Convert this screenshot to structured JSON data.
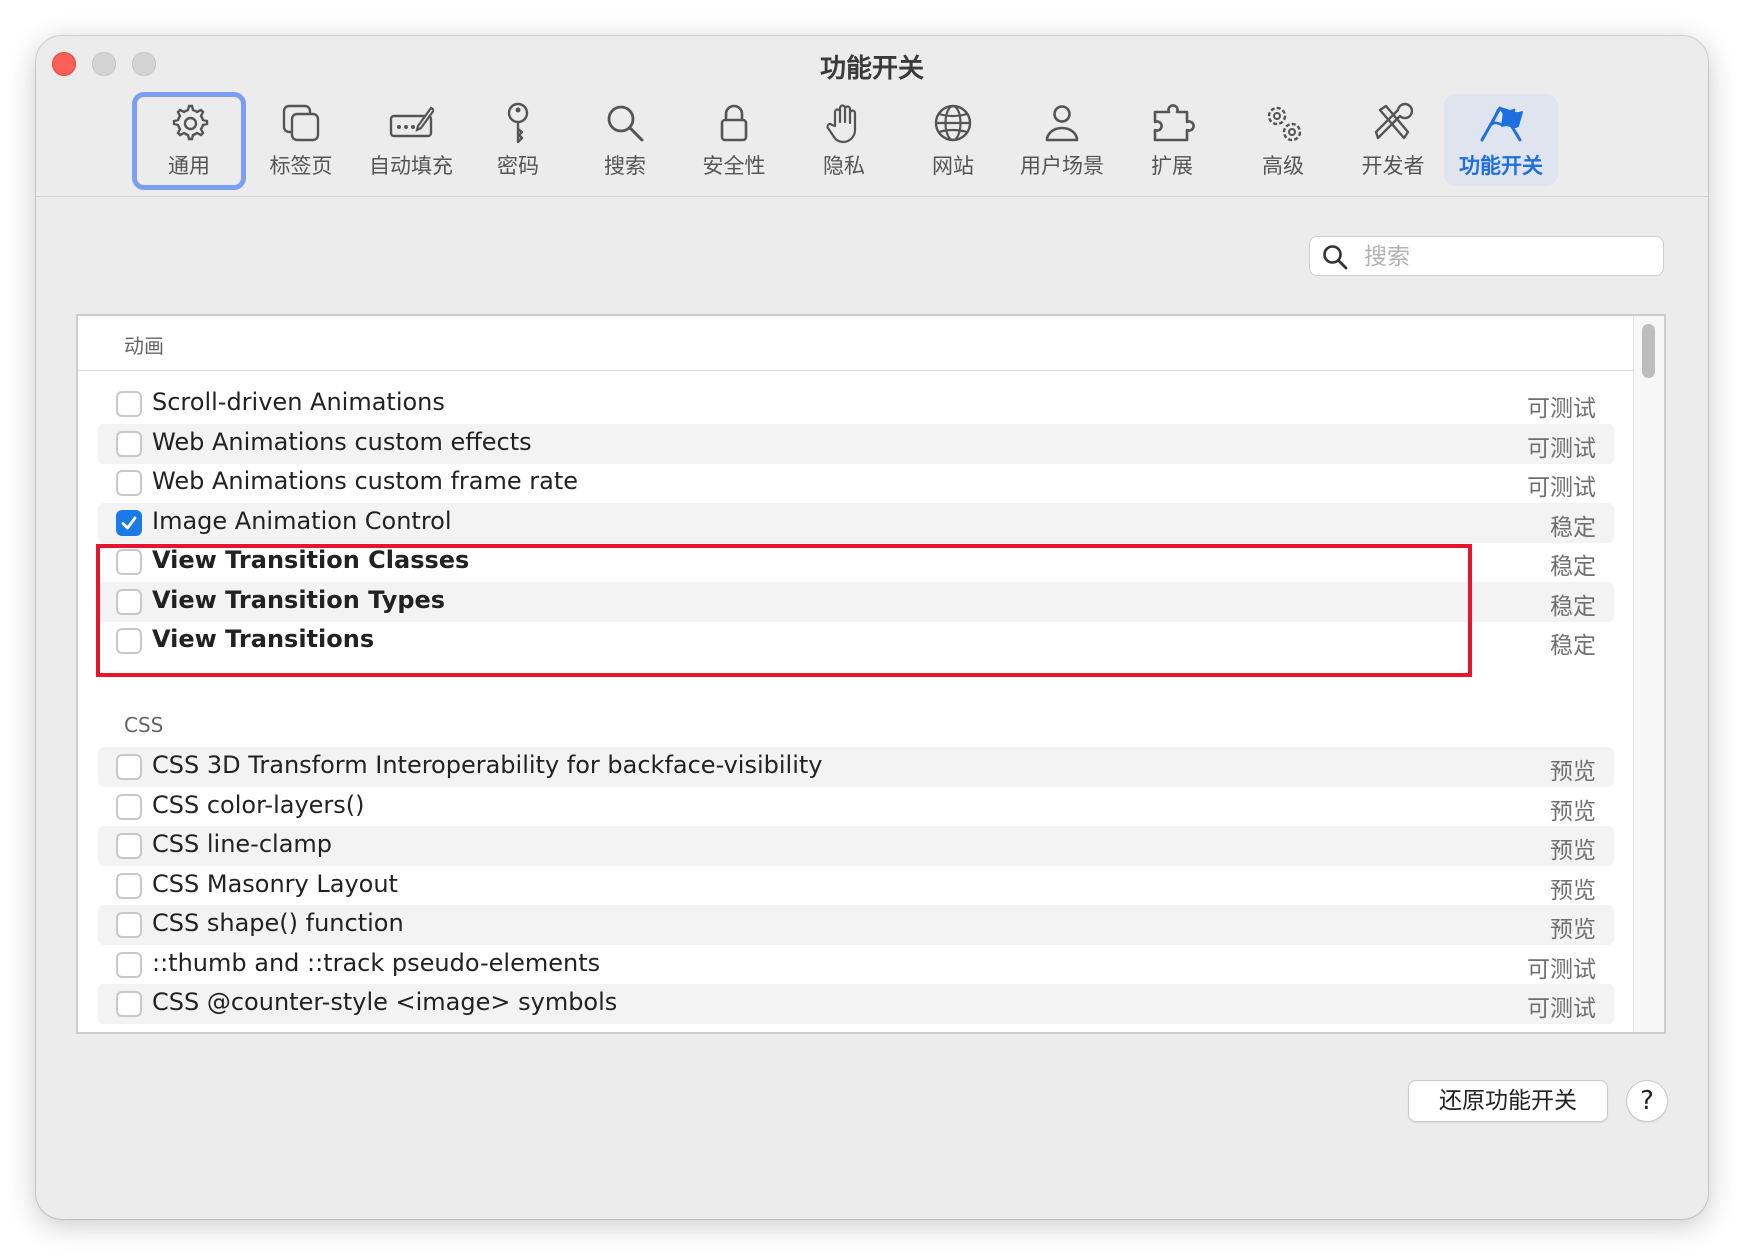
{
  "window": {
    "title": "功能开关"
  },
  "toolbar": {
    "items": [
      {
        "label": "通用",
        "icon": "gear-icon"
      },
      {
        "label": "标签页",
        "icon": "tabs-icon"
      },
      {
        "label": "自动填充",
        "icon": "autofill-icon"
      },
      {
        "label": "密码",
        "icon": "key-icon"
      },
      {
        "label": "搜索",
        "icon": "search-icon"
      },
      {
        "label": "安全性",
        "icon": "lock-icon"
      },
      {
        "label": "隐私",
        "icon": "hand-icon"
      },
      {
        "label": "网站",
        "icon": "globe-icon"
      },
      {
        "label": "用户场景",
        "icon": "person-icon"
      },
      {
        "label": "扩展",
        "icon": "puzzle-icon"
      },
      {
        "label": "高级",
        "icon": "gears-icon"
      },
      {
        "label": "开发者",
        "icon": "tools-icon"
      },
      {
        "label": "功能开关",
        "icon": "flags-icon"
      }
    ],
    "focused": "通用",
    "selected": "功能开关"
  },
  "search": {
    "placeholder": "搜索",
    "value": ""
  },
  "sections": [
    {
      "title": "动画",
      "rows": [
        {
          "name": "Scroll-driven Animations",
          "status": "可测试",
          "checked": false,
          "bold": false
        },
        {
          "name": "Web Animations custom effects",
          "status": "可测试",
          "checked": false,
          "bold": false
        },
        {
          "name": "Web Animations custom frame rate",
          "status": "可测试",
          "checked": false,
          "bold": false
        },
        {
          "name": "Image Animation Control",
          "status": "稳定",
          "checked": true,
          "bold": false
        },
        {
          "name": "View Transition Classes",
          "status": "稳定",
          "checked": false,
          "bold": true
        },
        {
          "name": "View Transition Types",
          "status": "稳定",
          "checked": false,
          "bold": true
        },
        {
          "name": "View Transitions",
          "status": "稳定",
          "checked": false,
          "bold": true
        }
      ]
    },
    {
      "title": "CSS",
      "rows": [
        {
          "name": "CSS 3D Transform Interoperability for backface-visibility",
          "status": "预览",
          "checked": false,
          "bold": false
        },
        {
          "name": "CSS color-layers()",
          "status": "预览",
          "checked": false,
          "bold": false
        },
        {
          "name": "CSS line-clamp",
          "status": "预览",
          "checked": false,
          "bold": false
        },
        {
          "name": "CSS Masonry Layout",
          "status": "预览",
          "checked": false,
          "bold": false
        },
        {
          "name": "CSS shape() function",
          "status": "预览",
          "checked": false,
          "bold": false
        },
        {
          "name": "::thumb and ::track pseudo-elements",
          "status": "可测试",
          "checked": false,
          "bold": false
        },
        {
          "name": "CSS @counter-style <image> symbols",
          "status": "可测试",
          "checked": false,
          "bold": false
        }
      ]
    }
  ],
  "footer": {
    "reset_label": "还原功能开关",
    "help_label": "?"
  },
  "colors": {
    "accent": "#1a7ae8",
    "highlight_border": "#e8142a",
    "focus_ring": "#7c9ef2"
  }
}
